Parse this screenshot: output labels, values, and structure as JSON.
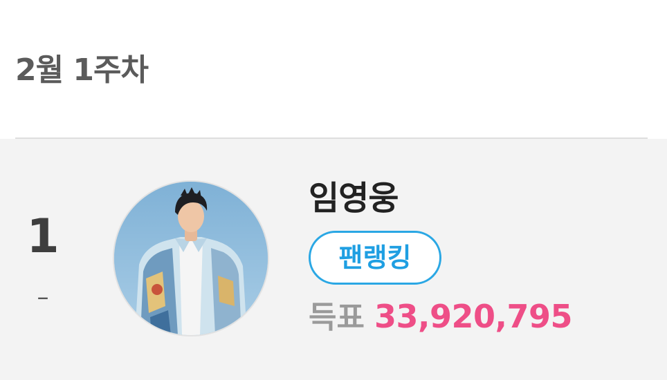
{
  "week": {
    "title": "2월 1주차"
  },
  "ranking": {
    "rank": "1",
    "change": "–",
    "artist": {
      "name": "임영웅",
      "avatar_icon": "artist-photo"
    },
    "badge_label": "팬랭킹",
    "votes_label": "득표",
    "votes_value": "33,920,795"
  },
  "colors": {
    "accent_blue": "#2aa7e4",
    "votes_pink": "#ee4e87",
    "card_bg": "#f3f3f3"
  }
}
